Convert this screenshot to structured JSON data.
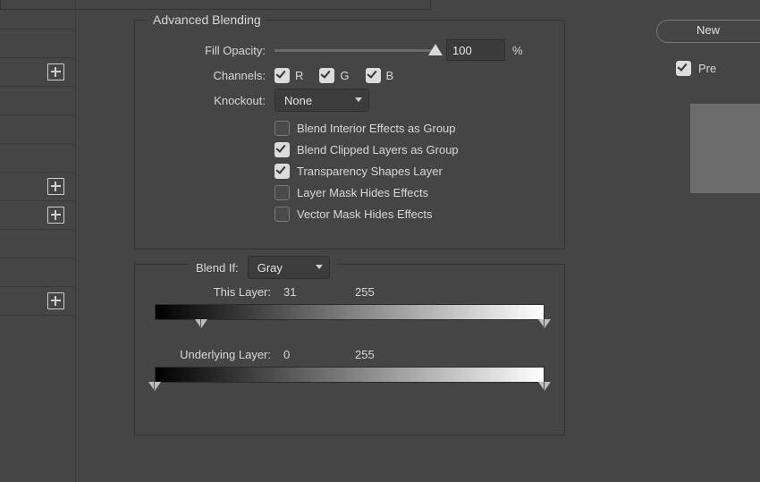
{
  "left_rows_with_plus": [
    2,
    5,
    6,
    9
  ],
  "advanced": {
    "title": "Advanced Blending",
    "fill_opacity_label": "Fill Opacity:",
    "fill_opacity_value": "100",
    "fill_opacity_pct": 100,
    "percent_sign": "%",
    "channels_label": "Channels:",
    "channel_r": "R",
    "channel_g": "G",
    "channel_b": "B",
    "channels_checked": {
      "r": true,
      "g": true,
      "b": true
    },
    "knockout_label": "Knockout:",
    "knockout_value": "None",
    "options": [
      {
        "key": "blend_interior",
        "label": "Blend Interior Effects as Group",
        "checked": false
      },
      {
        "key": "blend_clipped",
        "label": "Blend Clipped Layers as Group",
        "checked": true
      },
      {
        "key": "transparency_shapes",
        "label": "Transparency Shapes Layer",
        "checked": true
      },
      {
        "key": "layer_mask_hides",
        "label": "Layer Mask Hides Effects",
        "checked": false
      },
      {
        "key": "vector_mask_hides",
        "label": "Vector Mask Hides Effects",
        "checked": false
      }
    ]
  },
  "blend_if": {
    "label": "Blend If:",
    "channel": "Gray",
    "this_layer": {
      "label": "This Layer:",
      "low": "31",
      "high": "255",
      "low_pct": 12,
      "high_pct": 100
    },
    "underlying": {
      "label": "Underlying Layer:",
      "low": "0",
      "high": "255",
      "low_pct": 0,
      "high_pct": 100
    }
  },
  "right": {
    "new_button": "New",
    "preview_label": "Pre",
    "preview_checked": true
  }
}
